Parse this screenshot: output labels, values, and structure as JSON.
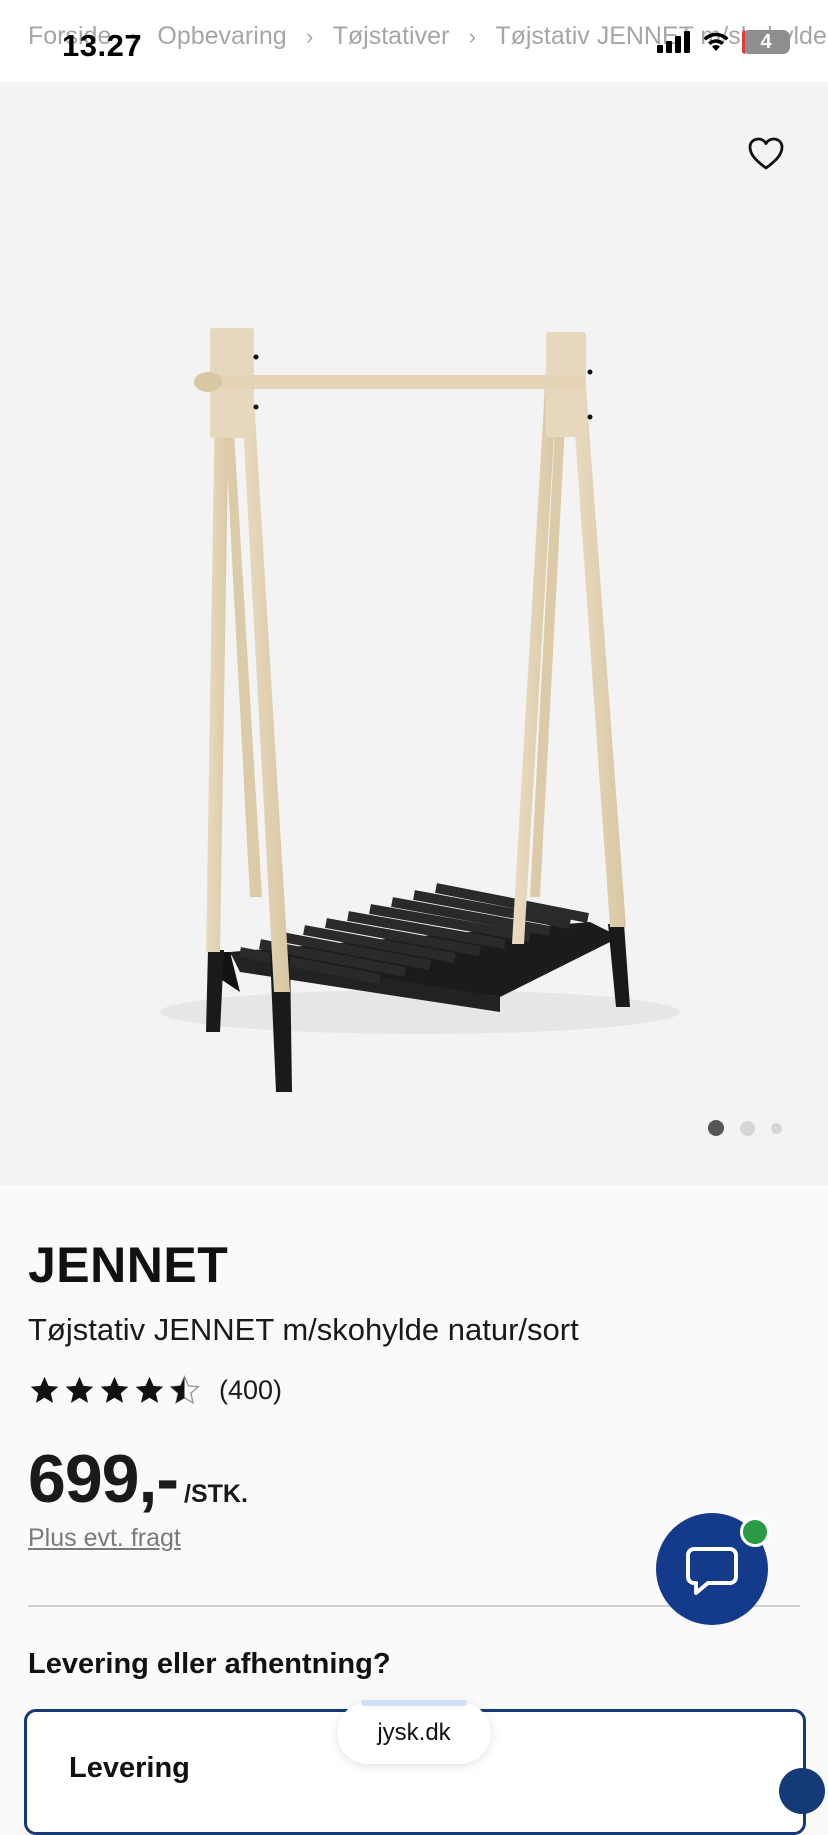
{
  "status_bar": {
    "time": "13.27",
    "battery": "4"
  },
  "breadcrumb": [
    "Forside",
    "Opbevaring",
    "Tøjstativer",
    "Tøjstativ JENNET m/skohylde"
  ],
  "breadcrumb_separator": "›",
  "gallery": {
    "image_count": 3,
    "active_index": 0
  },
  "product": {
    "brand": "JENNET",
    "title": "Tøjstativ JENNET m/skohylde natur/sort",
    "rating": 4.5,
    "rating_count": "(400)",
    "price": "699,-",
    "price_unit": "/STK.",
    "freight_link": "Plus evt. fragt"
  },
  "delivery": {
    "heading": "Levering eller afhentning?",
    "option_label": "Levering"
  },
  "browser": {
    "url": "jysk.dk"
  },
  "colors": {
    "brand_blue": "#143a8c",
    "online_green": "#2a9a45",
    "star": "#111111"
  }
}
